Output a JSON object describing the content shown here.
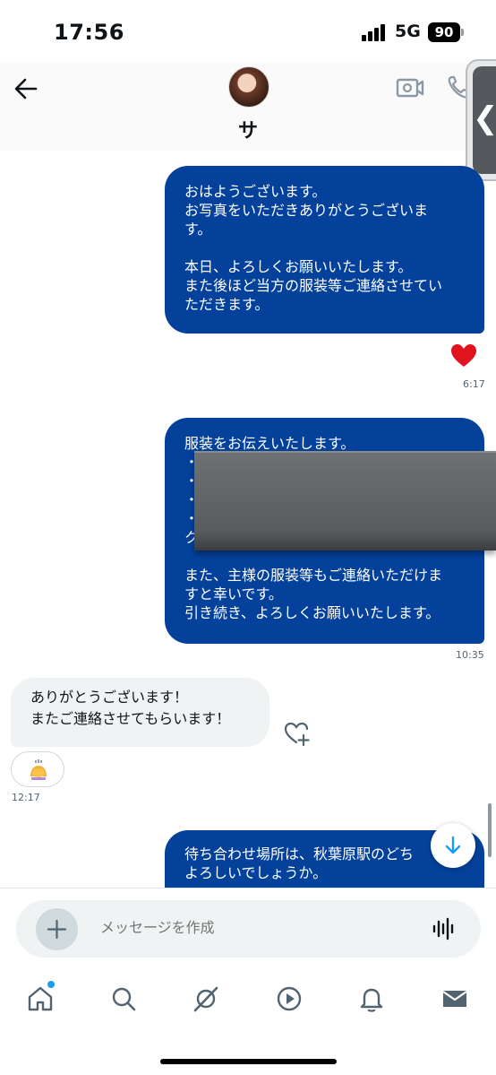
{
  "status_bar": {
    "time": "17:56",
    "network": "5G",
    "battery": "90"
  },
  "header": {
    "contact_name": "サ",
    "icons": [
      "back-arrow-icon",
      "video-call-icon",
      "phone-icon"
    ]
  },
  "messages": [
    {
      "type": "sent",
      "text": "おはようございます。\nお写真をいただきありがとうございま\nす。\n\n本日、よろしくお願いいたします。\nまた後ほど当方の服装等ご連絡させてい\nただきます。",
      "reaction": "❤️",
      "time": "6:17"
    },
    {
      "type": "sent",
      "text": "服装をお伝えいたします。\n・\n・\n・\n・\nク\n\nまた、主様の服装等もご連絡いただけま\nすと幸いです。\n引き続き、よろしくお願いいたします。",
      "time": "10:35"
    },
    {
      "type": "received",
      "text": "ありがとうございます！\nまたご連絡させてもらいます！",
      "reaction": "🙇‍♀️",
      "time": "12:17"
    },
    {
      "type": "sent",
      "text": "待ち合わせ場所は、秋葉原駅のどち\nよろしいでしょうか。"
    }
  ],
  "composer": {
    "placeholder": "メッセージを作成"
  },
  "tab_bar": {
    "items": [
      "home-icon",
      "search-icon",
      "grok-icon",
      "video-icon",
      "notifications-icon",
      "messages-icon"
    ],
    "home_has_badge": true
  },
  "colors": {
    "sent_bubble": "#04419b",
    "received_bubble": "#eff3f4",
    "accent": "#1d9bf0"
  }
}
